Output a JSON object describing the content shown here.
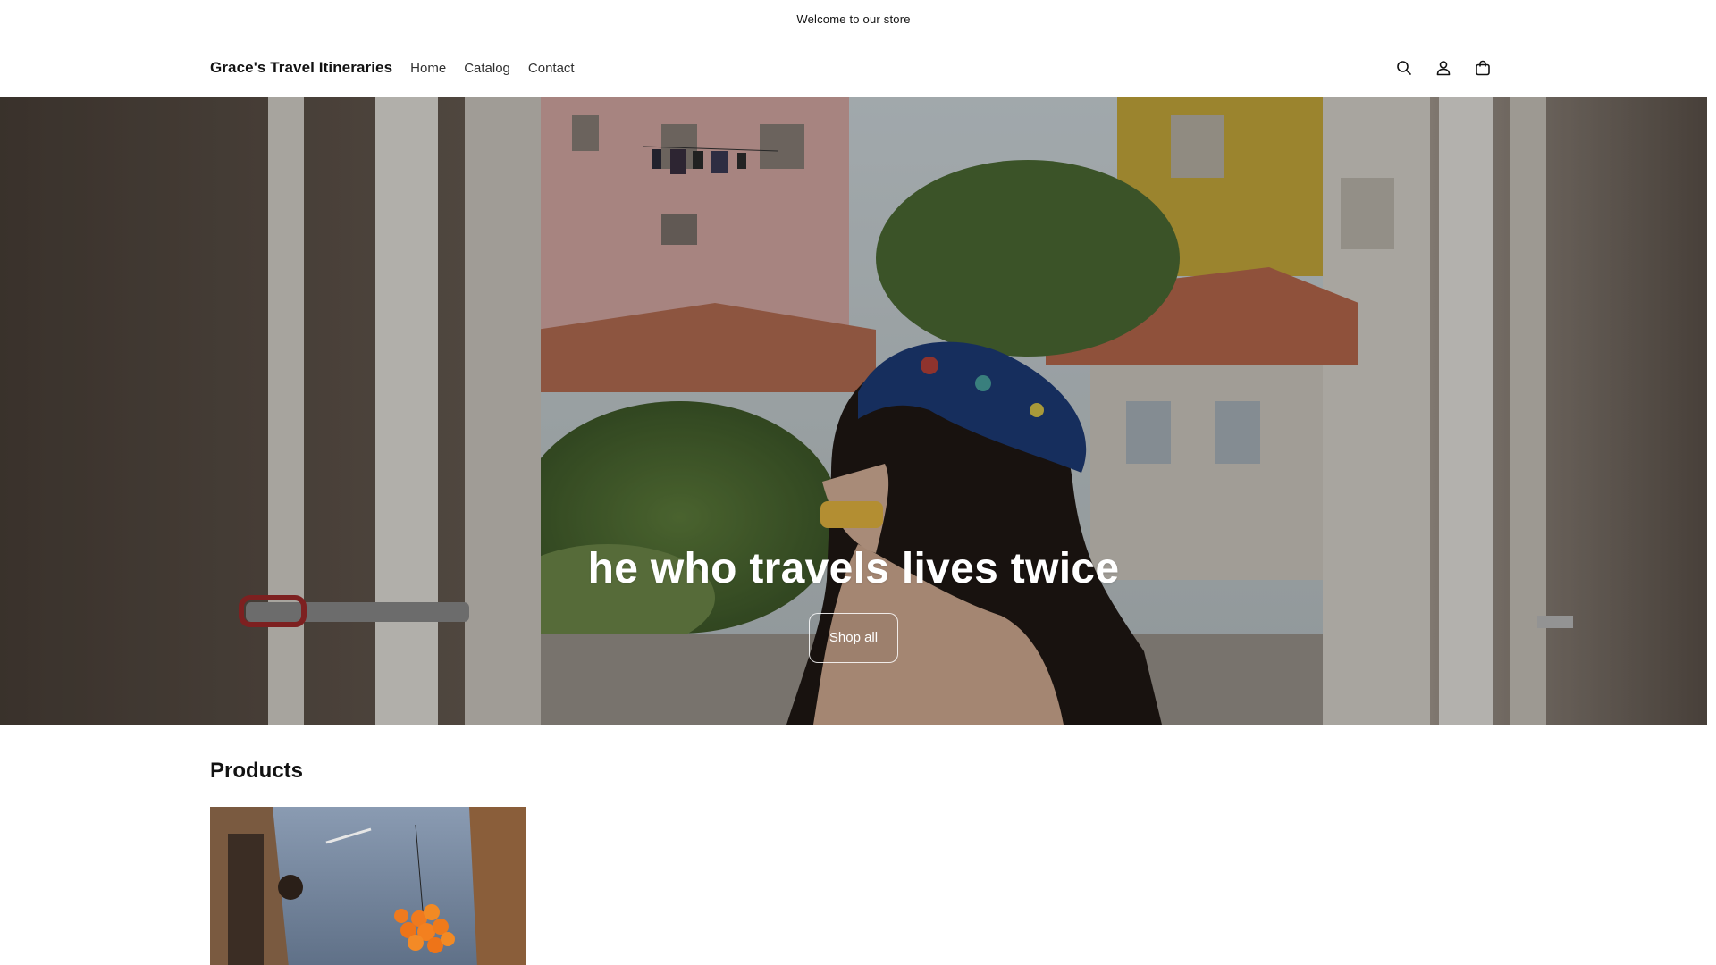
{
  "announcement": {
    "text": "Welcome to our store"
  },
  "header": {
    "logo": "Grace's Travel Itineraries",
    "nav": [
      {
        "label": "Home"
      },
      {
        "label": "Catalog"
      },
      {
        "label": "Contact"
      }
    ],
    "icons": [
      "search-icon",
      "account-icon",
      "cart-icon"
    ]
  },
  "hero": {
    "heading": "he who travels lives twice",
    "button_label": "Shop all"
  },
  "products": {
    "title": "Products"
  },
  "colors": {
    "text": "#121212",
    "background": "#ffffff",
    "border": "#e4e4e4",
    "hero_text": "#ffffff"
  }
}
